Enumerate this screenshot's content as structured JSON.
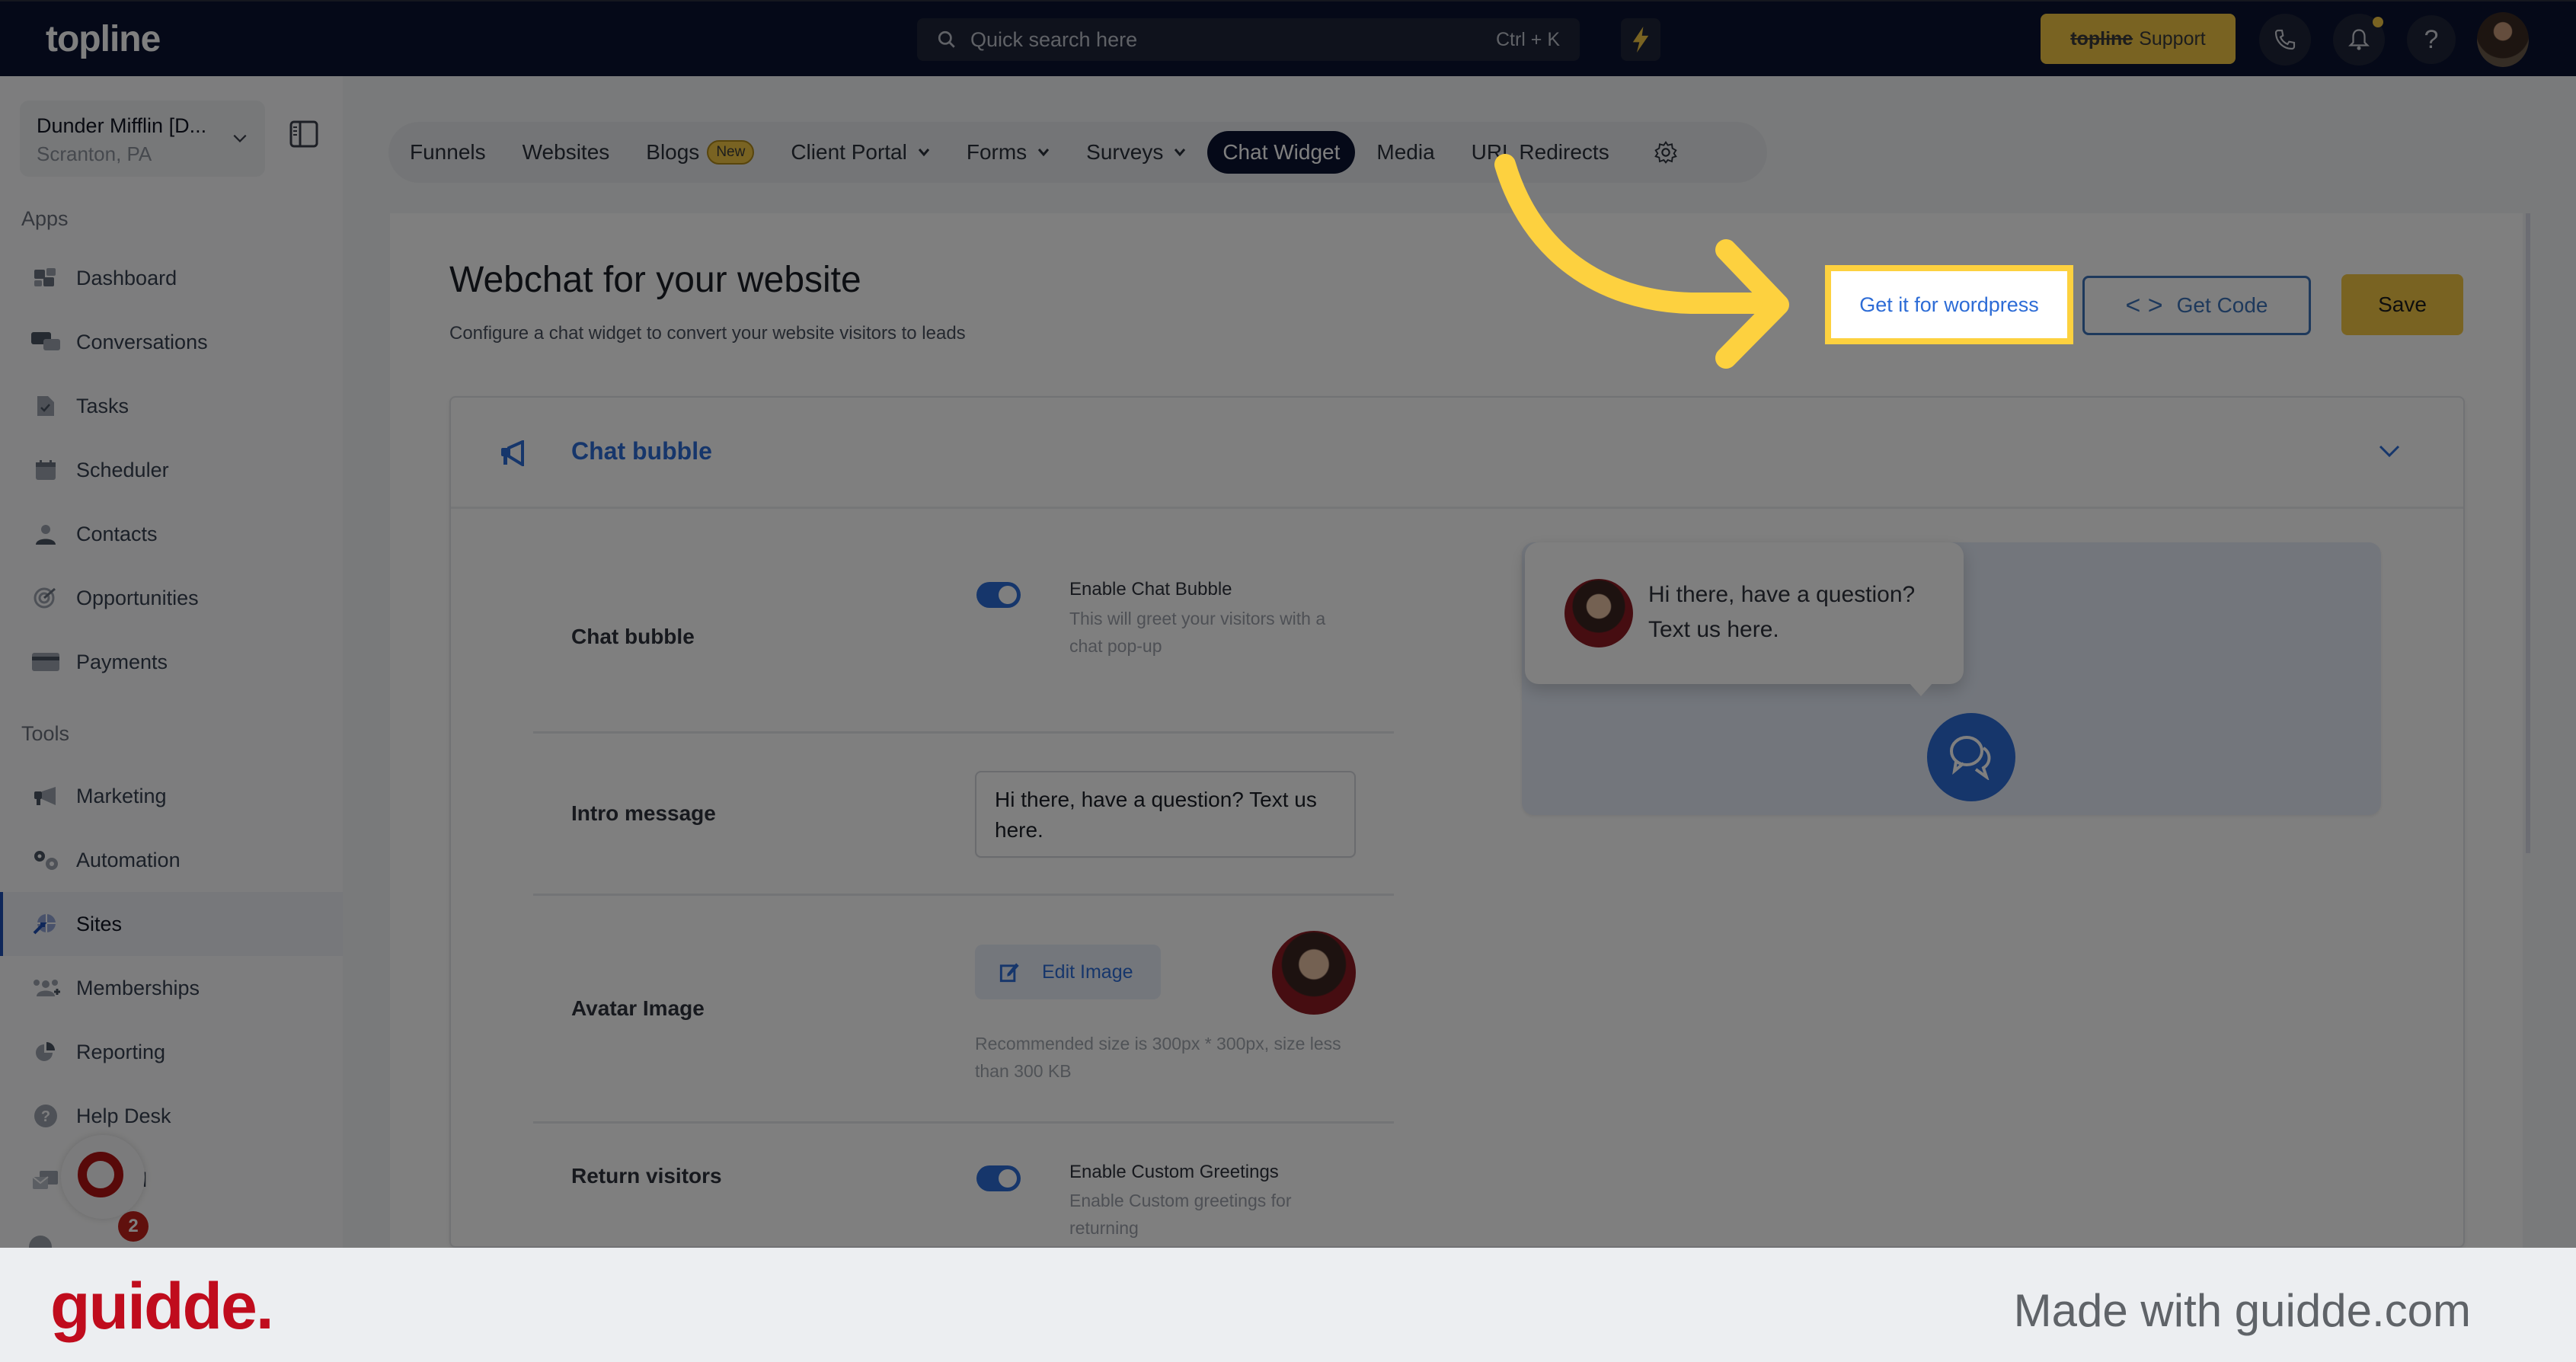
{
  "topbar": {
    "logo": "topline",
    "search_placeholder": "Quick search here",
    "search_shortcut": "Ctrl + K",
    "support_brand": "topline",
    "support_label": "Support",
    "accent": "#f2c744"
  },
  "account": {
    "name": "Dunder Mifflin [D...",
    "location": "Scranton, PA"
  },
  "sidebar": {
    "apps_label": "Apps",
    "apps": [
      {
        "label": "Dashboard",
        "icon": "dashboard-icon"
      },
      {
        "label": "Conversations",
        "icon": "conversations-icon"
      },
      {
        "label": "Tasks",
        "icon": "tasks-icon"
      },
      {
        "label": "Scheduler",
        "icon": "calendar-icon"
      },
      {
        "label": "Contacts",
        "icon": "contact-icon"
      },
      {
        "label": "Opportunities",
        "icon": "target-icon"
      },
      {
        "label": "Payments",
        "icon": "credit-card-icon"
      }
    ],
    "tools_label": "Tools",
    "tools": [
      {
        "label": "Marketing",
        "icon": "megaphone-icon"
      },
      {
        "label": "Automation",
        "icon": "gears-icon"
      },
      {
        "label": "Sites",
        "icon": "globe-icon",
        "active": true
      },
      {
        "label": "Memberships",
        "icon": "members-icon"
      },
      {
        "label": "Reporting",
        "icon": "pie-chart-icon"
      },
      {
        "label": "Help Desk",
        "icon": "help-icon"
      },
      {
        "label": "Mailfold",
        "icon": "mailfold-icon"
      }
    ],
    "chat_badge_count": "2"
  },
  "tabs": [
    {
      "label": "Funnels"
    },
    {
      "label": "Websites"
    },
    {
      "label": "Blogs",
      "badge": "New"
    },
    {
      "label": "Client Portal",
      "dropdown": true
    },
    {
      "label": "Forms",
      "dropdown": true
    },
    {
      "label": "Surveys",
      "dropdown": true
    },
    {
      "label": "Chat Widget",
      "active": true
    },
    {
      "label": "Media"
    },
    {
      "label": "URL Redirects"
    }
  ],
  "page": {
    "title": "Webchat for your website",
    "subtitle": "Configure a chat widget to convert your website visitors to leads",
    "wordpress_button": "Get it for wordpress",
    "get_code_button": "Get Code",
    "save_button": "Save"
  },
  "card": {
    "title": "Chat bubble",
    "rows": {
      "chat_bubble": {
        "label": "Chat bubble",
        "toggle_on": true,
        "option_title": "Enable Chat Bubble",
        "option_desc": "This will greet your visitors with a chat pop-up"
      },
      "intro": {
        "label": "Intro message",
        "value": "Hi there, have a question? Text us here."
      },
      "avatar": {
        "label": "Avatar Image",
        "edit_button": "Edit Image",
        "hint": "Recommended size is 300px * 300px, size less than 300 KB"
      },
      "return": {
        "label": "Return visitors",
        "toggle_on": true,
        "option_title": "Enable Custom Greetings",
        "option_desc": "Enable Custom greetings for returning"
      }
    },
    "preview_message": "Hi there, have a question? Text us here."
  },
  "footer": {
    "logo": "guidde.",
    "made_with": "Made with guidde.com"
  }
}
